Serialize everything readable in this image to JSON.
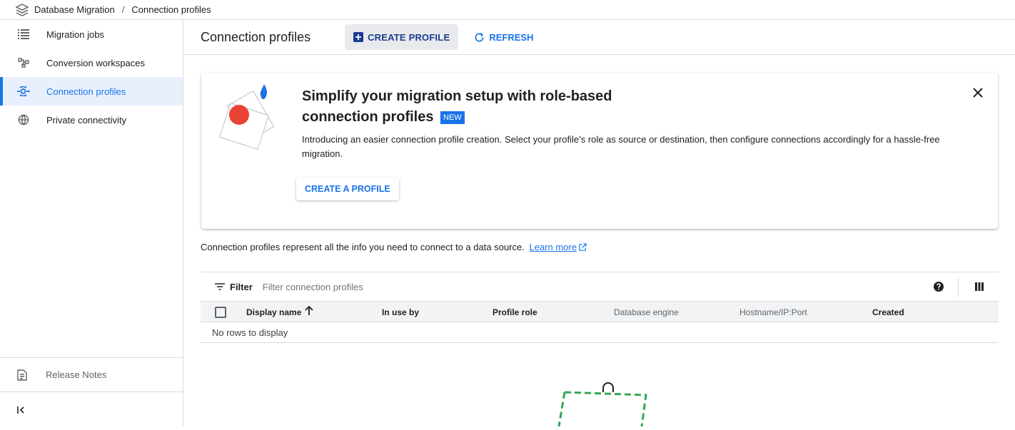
{
  "breadcrumb": {
    "app": "Database Migration",
    "separator": "/",
    "current": "Connection profiles"
  },
  "sidebar": {
    "items": [
      {
        "label": "Migration jobs",
        "icon": "list-icon",
        "active": false
      },
      {
        "label": "Conversion workspaces",
        "icon": "workspace-icon",
        "active": false
      },
      {
        "label": "Connection profiles",
        "icon": "connection-icon",
        "active": true
      },
      {
        "label": "Private connectivity",
        "icon": "globe-icon",
        "active": false
      }
    ],
    "release_notes": "Release Notes"
  },
  "header": {
    "title": "Connection profiles",
    "create_label": "CREATE PROFILE",
    "refresh_label": "REFRESH"
  },
  "banner": {
    "title": "Simplify your migration setup with role-based connection profiles",
    "badge": "NEW",
    "description": "Introducing an easier connection profile creation. Select your profile’s role as source or destination, then configure connections accordingly for a hassle-free migration.",
    "button_label": "CREATE A PROFILE"
  },
  "info": {
    "text": "Connection profiles represent all the info you need to connect to a data source.",
    "link": "Learn more"
  },
  "filter": {
    "label": "Filter",
    "placeholder": "Filter connection profiles"
  },
  "table": {
    "columns": [
      "Display name",
      "In use by",
      "Profile role",
      "Database engine",
      "Hostname/IP:Port",
      "Created"
    ],
    "sort_column": "Display name",
    "empty_text": "No rows to display"
  },
  "colors": {
    "accent": "#1a73e8",
    "active_bg": "#e8f0fe",
    "illustration_red": "#ea4335",
    "illustration_green": "#34a853"
  }
}
